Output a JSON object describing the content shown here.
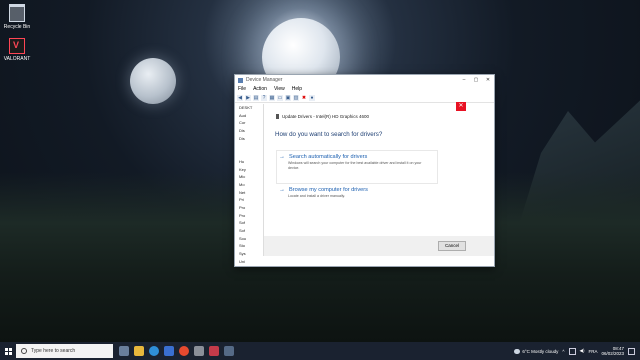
{
  "desktop": {
    "icons": [
      {
        "label": "Recycle Bin"
      },
      {
        "label": "VALORANT"
      }
    ]
  },
  "device_manager": {
    "title": "Device Manager",
    "menu": [
      "File",
      "Action",
      "View",
      "Help"
    ],
    "tree_root": "DESKT",
    "tree_items": [
      "Aud",
      "Cor",
      "Dis",
      "Dis",
      "",
      "",
      "Hu",
      "Key",
      "Mic",
      "Mo",
      "Net",
      "Pri",
      "Pro",
      "Pro",
      "Sof",
      "Sof",
      "Sou",
      "Sto",
      "Sys",
      "Uni"
    ]
  },
  "update_drivers": {
    "header": "Update Drivers - Intel(R) HD Graphics 4600",
    "question": "How do you want to search for drivers?",
    "option_auto": {
      "title": "Search automatically for drivers",
      "description": "Windows will search your computer for the best available driver and install it on your device."
    },
    "option_browse": {
      "title": "Browse my computer for drivers",
      "description": "Locate and install a driver manually."
    },
    "cancel_label": "Cancel",
    "close_glyph": "✕"
  },
  "taskbar": {
    "search_placeholder": "Type here to search",
    "weather": "6°C  Mostly cloudy",
    "language": "FRA",
    "time": "08:47",
    "date": "06/02/2023"
  }
}
